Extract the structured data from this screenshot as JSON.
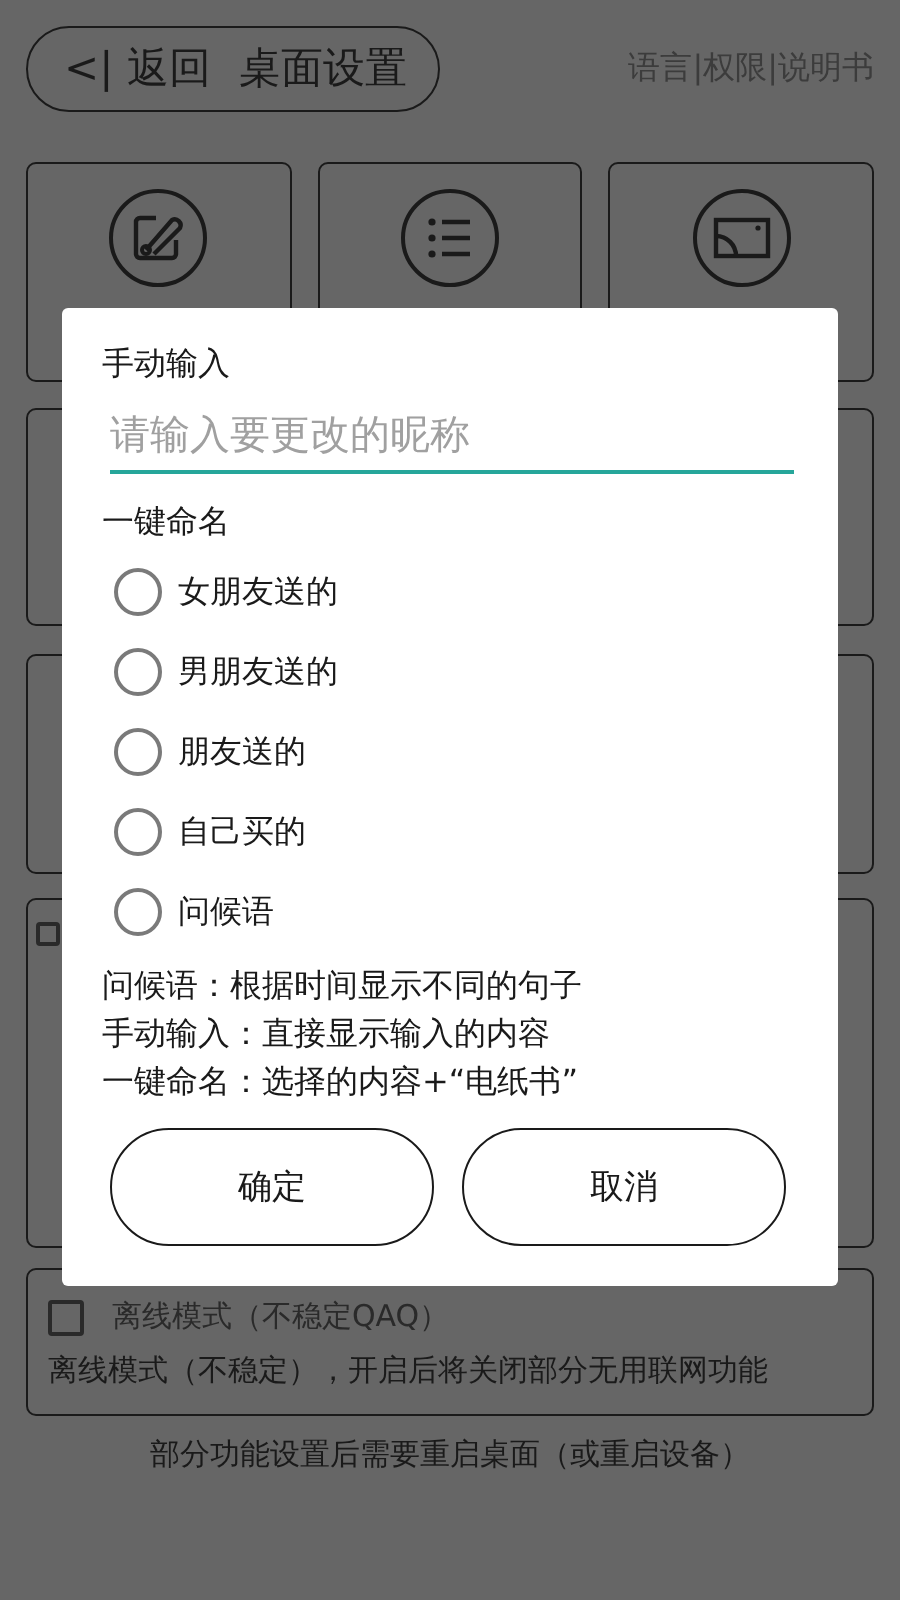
{
  "header": {
    "back_label": "<| 返回",
    "title": "桌面设置",
    "links": "语言|权限|说明书"
  },
  "tiles": [
    {
      "kind": "edit"
    },
    {
      "kind": "list"
    },
    {
      "kind": "screen"
    }
  ],
  "covered_card": {
    "checked": false
  },
  "offline": {
    "checked": false,
    "label": "离线模式（不稳定QAQ）",
    "description": "离线模式（不稳定），开启后将关闭部分无用联网功能"
  },
  "footer": "部分功能设置后需要重启桌面（或重启设备）",
  "dialog": {
    "manual_label": "手动输入",
    "input": {
      "placeholder": "请输入要更改的昵称"
    },
    "quick_label": "一键命名",
    "options": [
      {
        "label": "女朋友送的",
        "selected": false
      },
      {
        "label": "男朋友送的",
        "selected": false
      },
      {
        "label": "朋友送的",
        "selected": false
      },
      {
        "label": "自己买的",
        "selected": false
      },
      {
        "label": "问候语",
        "selected": false
      }
    ],
    "notes": [
      "问候语：根据时间显示不同的句子",
      "手动输入：直接显示输入的内容",
      "一键命名：选择的内容+“电纸书”"
    ],
    "buttons": [
      "确定",
      "取消"
    ]
  }
}
